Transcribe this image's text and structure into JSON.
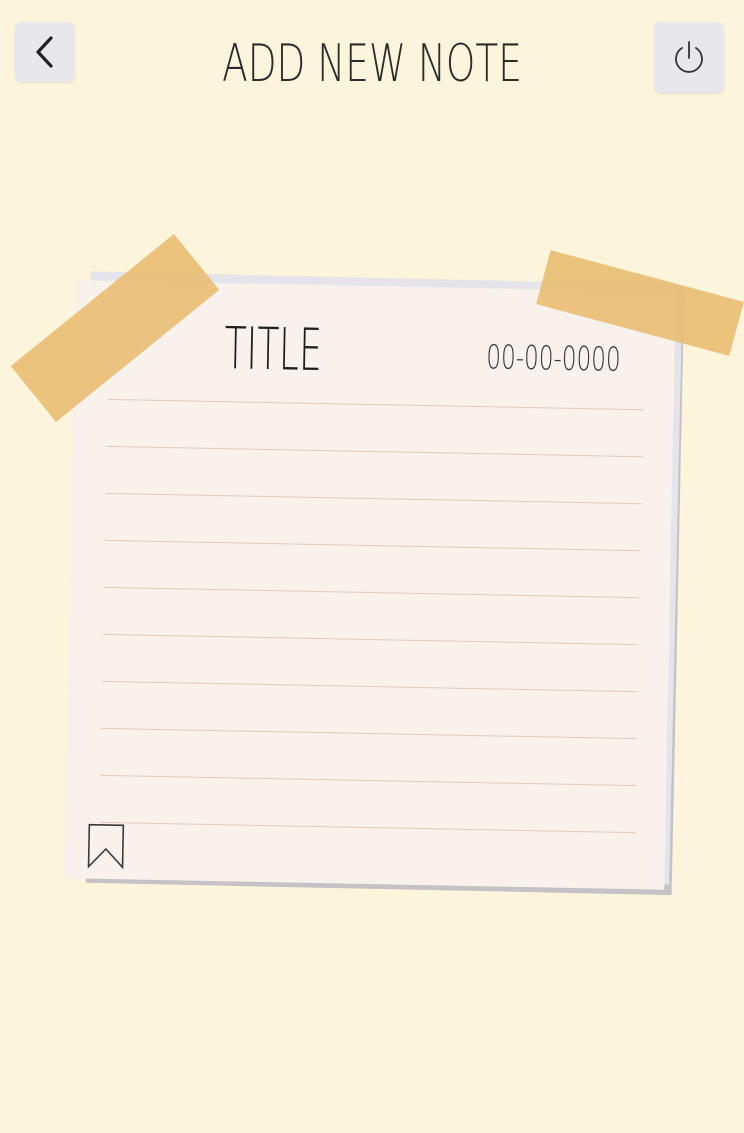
{
  "header": {
    "title": "ADD NEW NOTE",
    "back_icon": "chevron-left-icon",
    "power_icon": "power-icon"
  },
  "note": {
    "title": "TITLE",
    "date": "00-00-0000",
    "bookmark_icon": "bookmark-icon"
  },
  "colors": {
    "background": "#fdf4dc",
    "paper": "#f8f1ec",
    "tape": "#e8bc6e",
    "rule": "#e6c9b6",
    "button": "#e7e7ec"
  }
}
